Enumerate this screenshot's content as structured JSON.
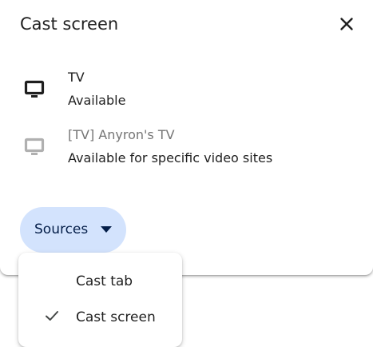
{
  "dialog": {
    "title": "Cast screen",
    "close_icon": "close-icon"
  },
  "sinks": [
    {
      "name": "TV",
      "status": "Available",
      "icon": "tv-icon",
      "enabled": true
    },
    {
      "name": "[TV] Anyron's TV",
      "status": "Available for specific video sites",
      "icon": "tv-icon",
      "enabled": false
    }
  ],
  "sources": {
    "label": "Sources",
    "icon": "dropdown-caret-icon",
    "menu": [
      {
        "label": "Cast tab",
        "selected": false
      },
      {
        "label": "Cast screen",
        "selected": true
      }
    ]
  },
  "colors": {
    "sources_button_bg": "#d3e3fd",
    "sources_button_text": "#041e49",
    "icon_active": "#1f1f1f",
    "icon_disabled": "#b0b0b0",
    "text_disabled": "#757575",
    "checkmark": "#444746"
  }
}
